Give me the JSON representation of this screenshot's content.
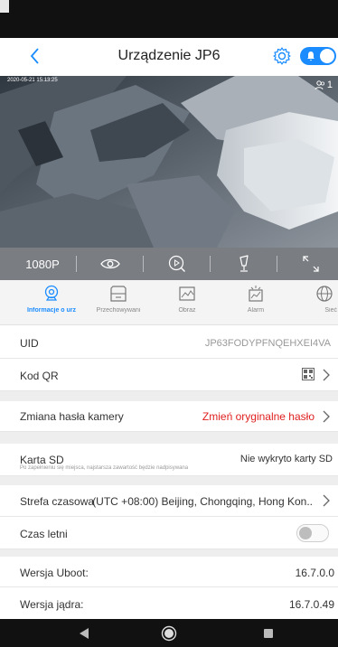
{
  "header": {
    "title": "Urządzenie JP6",
    "back_icon": "chevron-left-icon",
    "settings_icon": "gear-icon",
    "alarm_toggle_on": true,
    "accent": "#1a8cff"
  },
  "video": {
    "timestamp": "2020-05-21 15:13:25",
    "viewer_count": "1",
    "quality": "1080P",
    "controls": [
      "eye-icon",
      "playback-icon",
      "microphone-icon",
      "fullscreen-icon"
    ]
  },
  "tabs": [
    {
      "label": "Informacje o urz",
      "icon": "info-camera-icon",
      "active": true
    },
    {
      "label": "Przechowywani",
      "icon": "storage-icon",
      "active": false
    },
    {
      "label": "Obraz",
      "icon": "image-icon",
      "active": false
    },
    {
      "label": "Alarm",
      "icon": "alarm-icon",
      "active": false
    },
    {
      "label": "Sieć",
      "icon": "globe-icon",
      "active": false
    }
  ],
  "rows": {
    "uid_label": "UID",
    "uid_value": "JP63FODYPFNQEHXEI4VA",
    "qr_label": "Kod QR",
    "password_label": "Zmiana hasła kamery",
    "password_value": "Zmień oryginalne hasło",
    "password_color": "#e02020",
    "sd_label": "Karta SD",
    "sd_value": "Nie wykryto karty SD",
    "sd_note": "Po zapełnieniu się miejsca, najstarsza zawartość będzie nadpisywana",
    "tz_label": "Strefa czasowa",
    "tz_value": "(UTC +08:00) Beijing, Chongqing, Hong Kon..",
    "dst_label": "Czas letni",
    "dst_on": false,
    "uboot_label": "Wersja Uboot:",
    "uboot_value": "16.7.0.0",
    "kernel_label": "Wersja jądra:",
    "kernel_value": "16.7.0.49"
  },
  "system_nav": [
    "back-triangle-icon",
    "home-circle-icon",
    "recents-square-icon"
  ]
}
